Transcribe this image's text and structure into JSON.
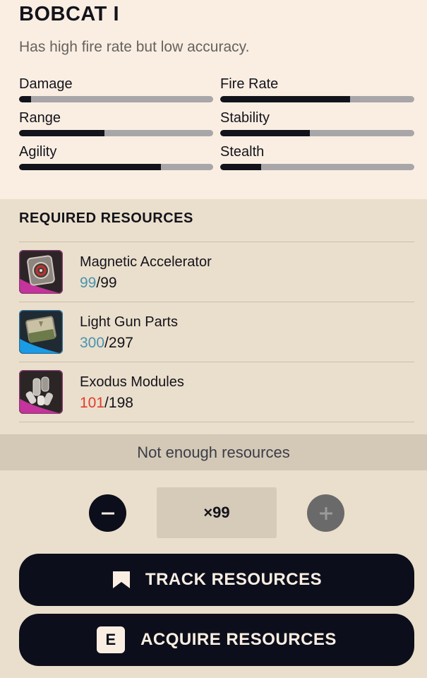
{
  "item": {
    "title": "BOBCAT I",
    "description": "Has high fire rate but low accuracy."
  },
  "stats": [
    {
      "label": "Damage",
      "value": 0.06
    },
    {
      "label": "Fire Rate",
      "value": 0.67
    },
    {
      "label": "Range",
      "value": 0.44
    },
    {
      "label": "Stability",
      "value": 0.46
    },
    {
      "label": "Agility",
      "value": 0.73
    },
    {
      "label": "Stealth",
      "value": 0.21
    }
  ],
  "resources": {
    "heading": "REQUIRED RESOURCES",
    "items": [
      {
        "name": "Magnetic Accelerator",
        "have": "99",
        "need": "99",
        "have_color": "#4a93b0",
        "icon": "magnetic-accelerator-icon",
        "rarity_color": "#c4349c"
      },
      {
        "name": "Light Gun Parts",
        "have": "300",
        "need": "297",
        "have_color": "#4a93b0",
        "icon": "light-gun-parts-icon",
        "rarity_color": "#1b9be6"
      },
      {
        "name": "Exodus Modules",
        "have": "101",
        "need": "198",
        "have_color": "#e23c2c",
        "icon": "exodus-modules-icon",
        "rarity_color": "#c4349c"
      }
    ]
  },
  "status_text": "Not enough resources",
  "quantity": {
    "value": "×99",
    "decrement_icon": "minus-icon",
    "increment_icon": "plus-icon"
  },
  "buttons": {
    "track_label": "TRACK RESOURCES",
    "track_icon": "bookmark-icon",
    "acquire_key": "E",
    "acquire_label": "ACQUIRE RESOURCES"
  },
  "colors": {
    "top_bg": "#faeee2",
    "body_bg": "#eadfcc",
    "bar_fill": "#12131b",
    "bar_track": "#a8a6a8",
    "button_bg": "#0c0e1b",
    "count_ok": "#4a93b0",
    "count_short": "#e23c2c"
  }
}
